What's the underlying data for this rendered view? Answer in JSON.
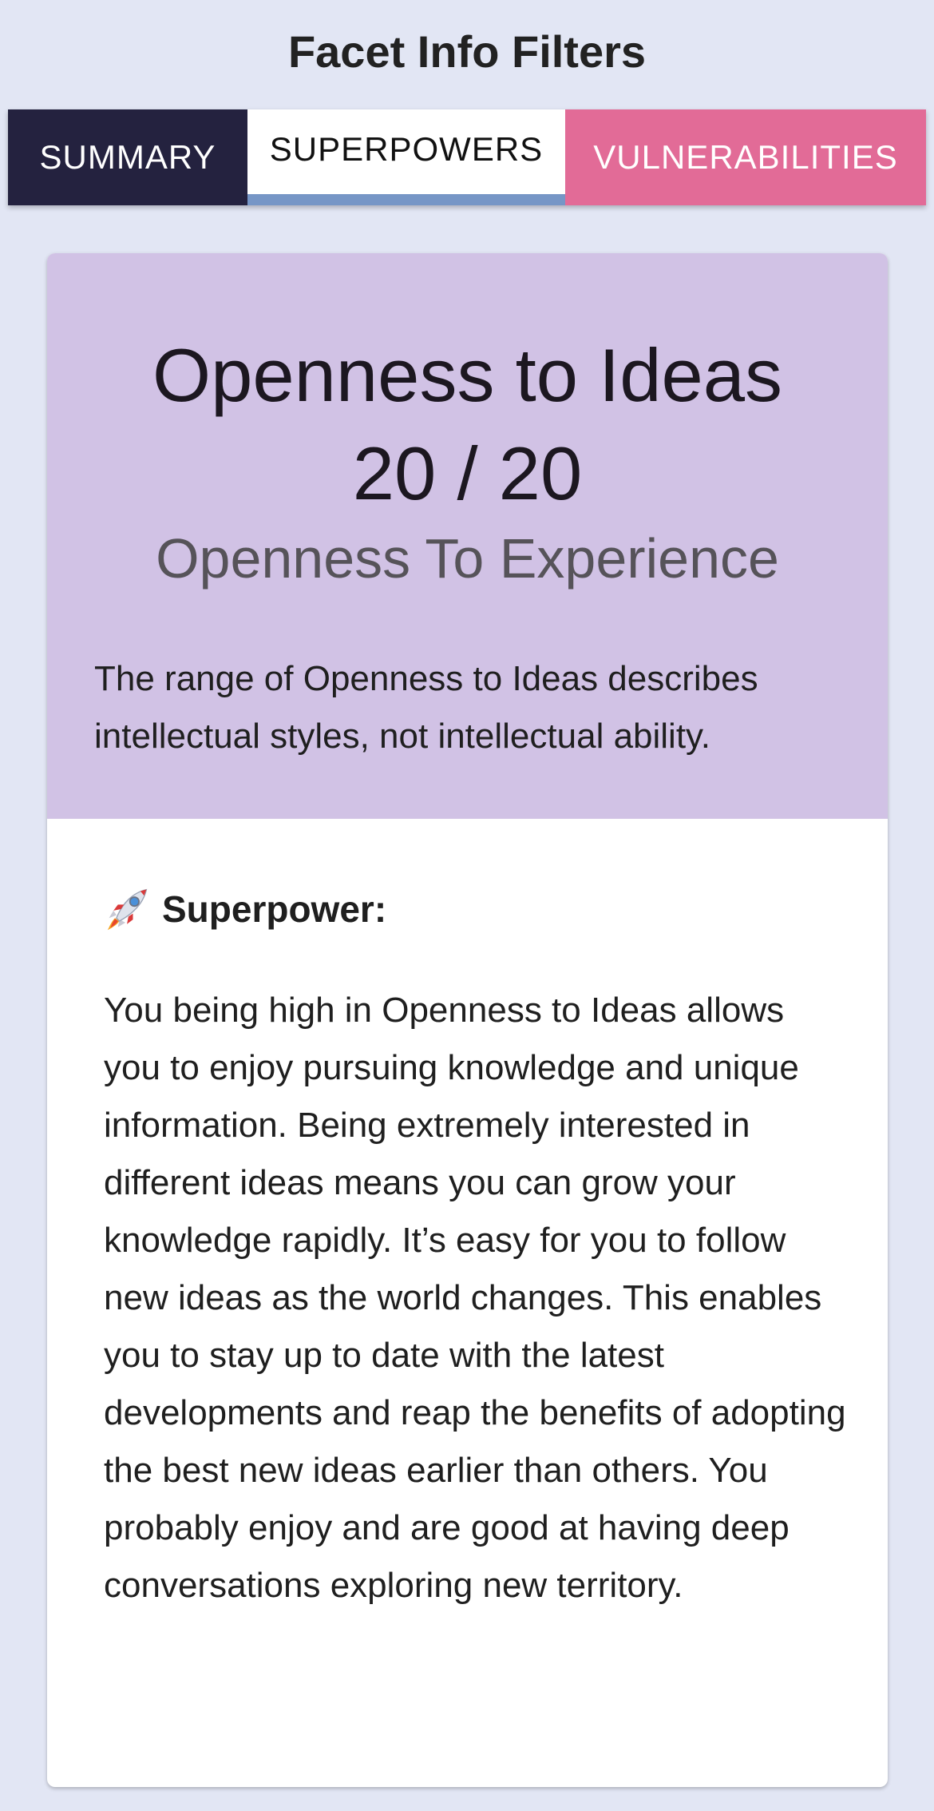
{
  "header": {
    "title": "Facet Info Filters"
  },
  "tabs": [
    {
      "label": "SUMMARY",
      "color": "#24223f"
    },
    {
      "label": "SUPERPOWERS",
      "color": "#ffffff",
      "active": true
    },
    {
      "label": "VULNERABILITIES",
      "color": "#e26b97"
    }
  ],
  "card": {
    "facet_name": "Openness to Ideas",
    "score": "20 / 20",
    "domain": "Openness To Experience",
    "description": "The range of Openness to Ideas describes intellectual styles, not intellectual ability.",
    "header_color": "#d1c2e5",
    "section": {
      "icon": "rocket-icon",
      "label": "Superpower:",
      "text": "You being high in Openness to Ideas allows you to enjoy pursuing knowledge and unique information. Being extremely interested in different ideas means you can grow your knowledge rapidly. It’s easy for you to follow new ideas as the world changes. This enables you to stay up to date with the latest developments and reap the benefits of adopting the best new ideas earlier than others. You probably enjoy and are good at having deep conversations exploring new territory."
    }
  },
  "colors": {
    "background": "#e2e6f4",
    "tab_indicator": "#7696c6"
  }
}
